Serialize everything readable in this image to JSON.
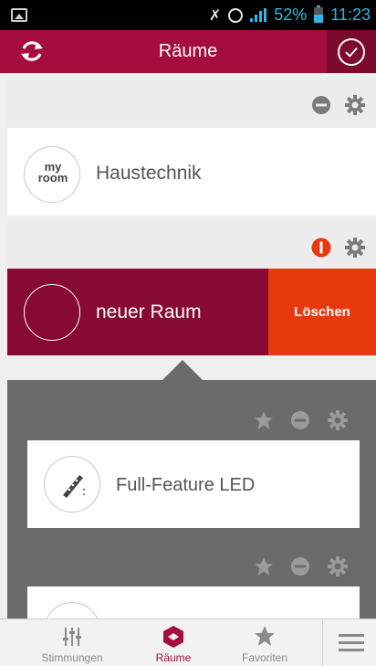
{
  "status_bar": {
    "battery": "52%",
    "time": "11:23"
  },
  "header": {
    "title": "Räume",
    "refresh_icon": "refresh-icon",
    "confirm_icon": "check-circle-icon"
  },
  "rooms": [
    {
      "name": "Haustechnik",
      "logo_text": "my room"
    },
    {
      "name": "neuer Raum",
      "action_label": "Löschen"
    }
  ],
  "devices": [
    {
      "name": "Full-Feature LED"
    },
    {
      "name": ""
    }
  ],
  "bottom_nav": {
    "items": [
      {
        "label": "Stimmungen",
        "icon": "sliders-icon",
        "active": false
      },
      {
        "label": "Räume",
        "icon": "rooms-icon",
        "active": true
      },
      {
        "label": "Favoriten",
        "icon": "star-icon",
        "active": false
      }
    ],
    "menu_icon": "hamburger-menu-icon"
  },
  "colors": {
    "brand": "#a50d3c",
    "selected_room": "#870a35",
    "delete": "#e8390d",
    "warning": "#e8390d",
    "device_area": "#6b6b6b"
  }
}
